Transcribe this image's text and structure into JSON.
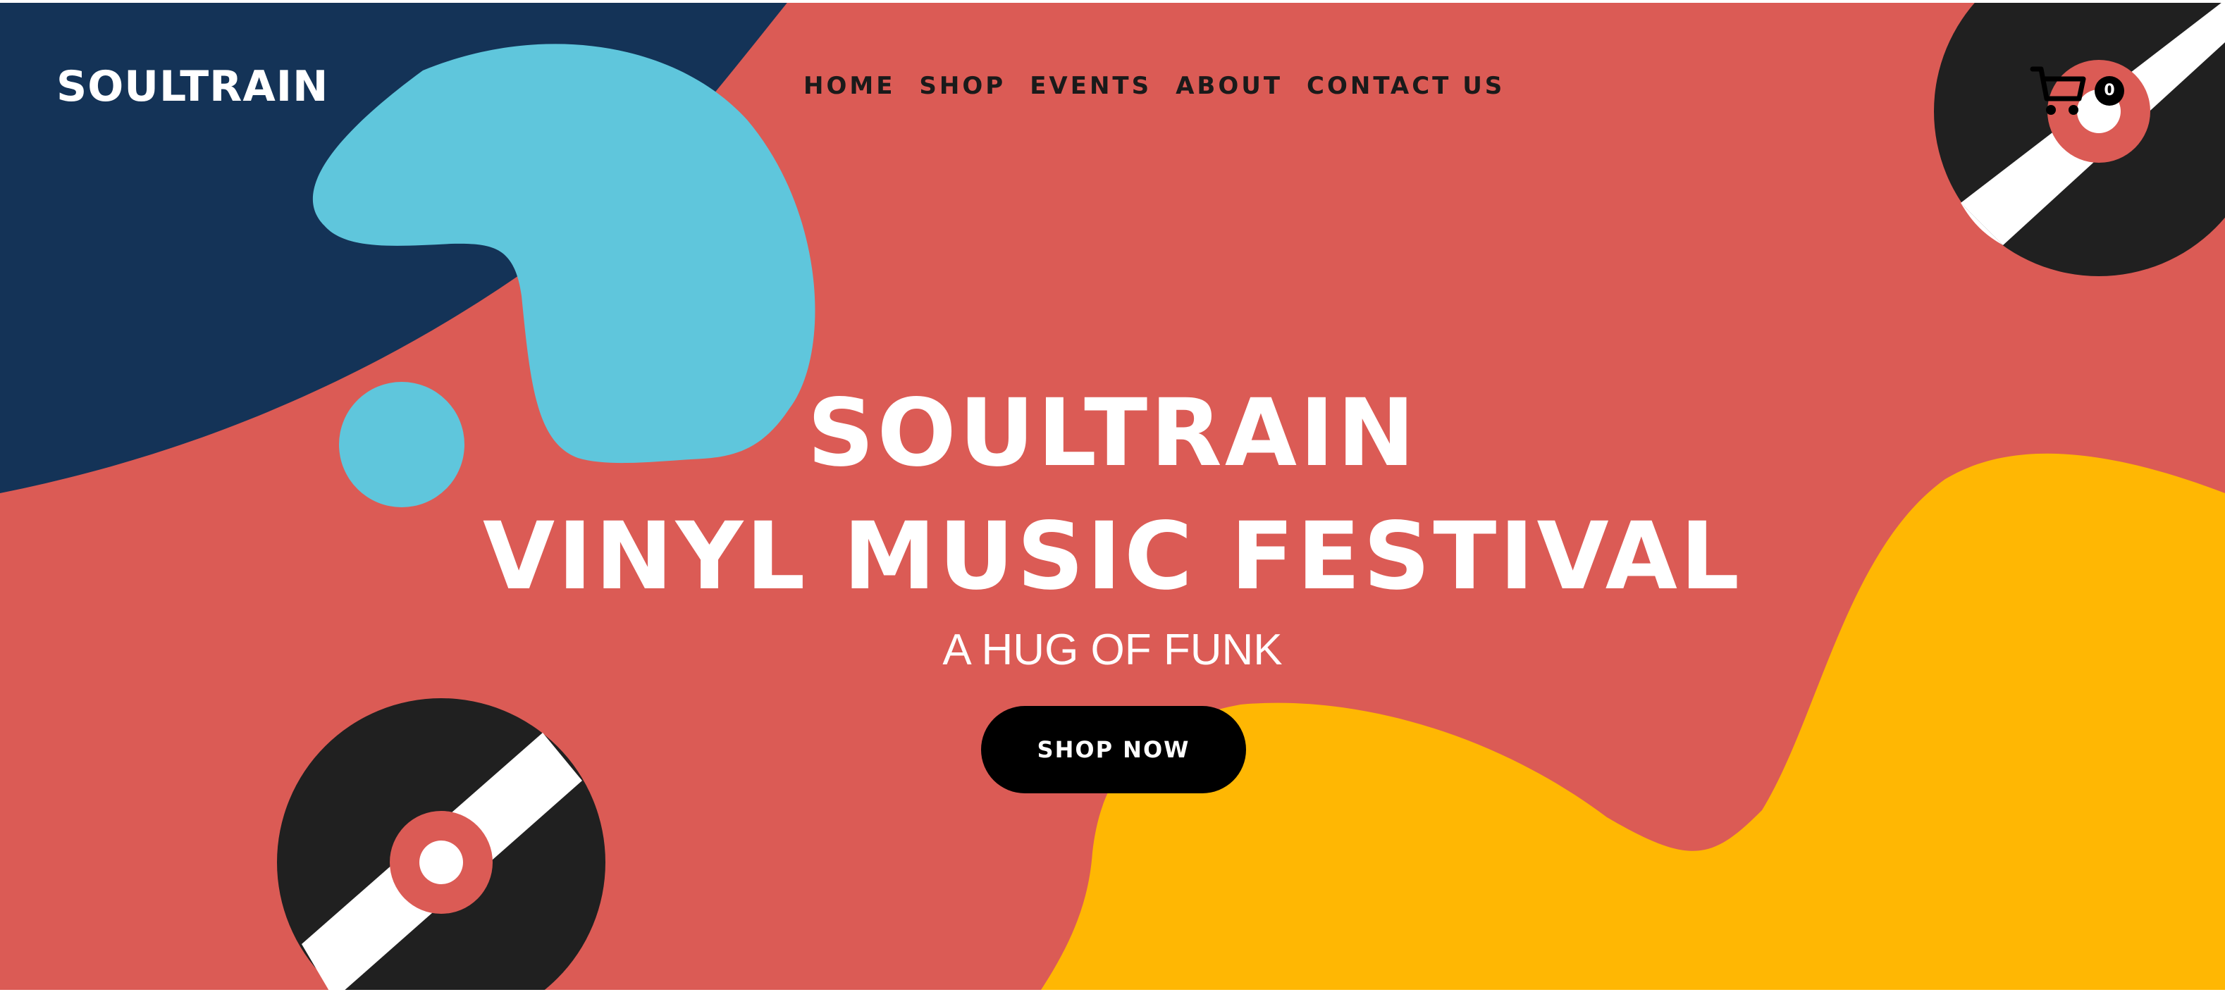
{
  "header": {
    "logo": "SOULTRAIN",
    "nav": [
      "HOME",
      "SHOP",
      "EVENTS",
      "ABOUT",
      "CONTACT US"
    ],
    "cart": {
      "icon": "cart-icon",
      "count": "0"
    }
  },
  "hero": {
    "title_line_1": "SOULTRAIN",
    "title_line_2": "VINYL MUSIC FESTIVAL",
    "subtitle": "A HUG OF FUNK",
    "cta_label": "SHOP NOW"
  },
  "colors": {
    "background": "#db5b55",
    "navy": "#143357",
    "sky": "#5fc6dc",
    "yellow": "#ffb703",
    "vinyl": "#202020",
    "text_light": "#ffffff",
    "text_dark": "#1a1a1a"
  },
  "decorations": [
    "vinyl-record-icon",
    "vinyl-record-icon"
  ]
}
